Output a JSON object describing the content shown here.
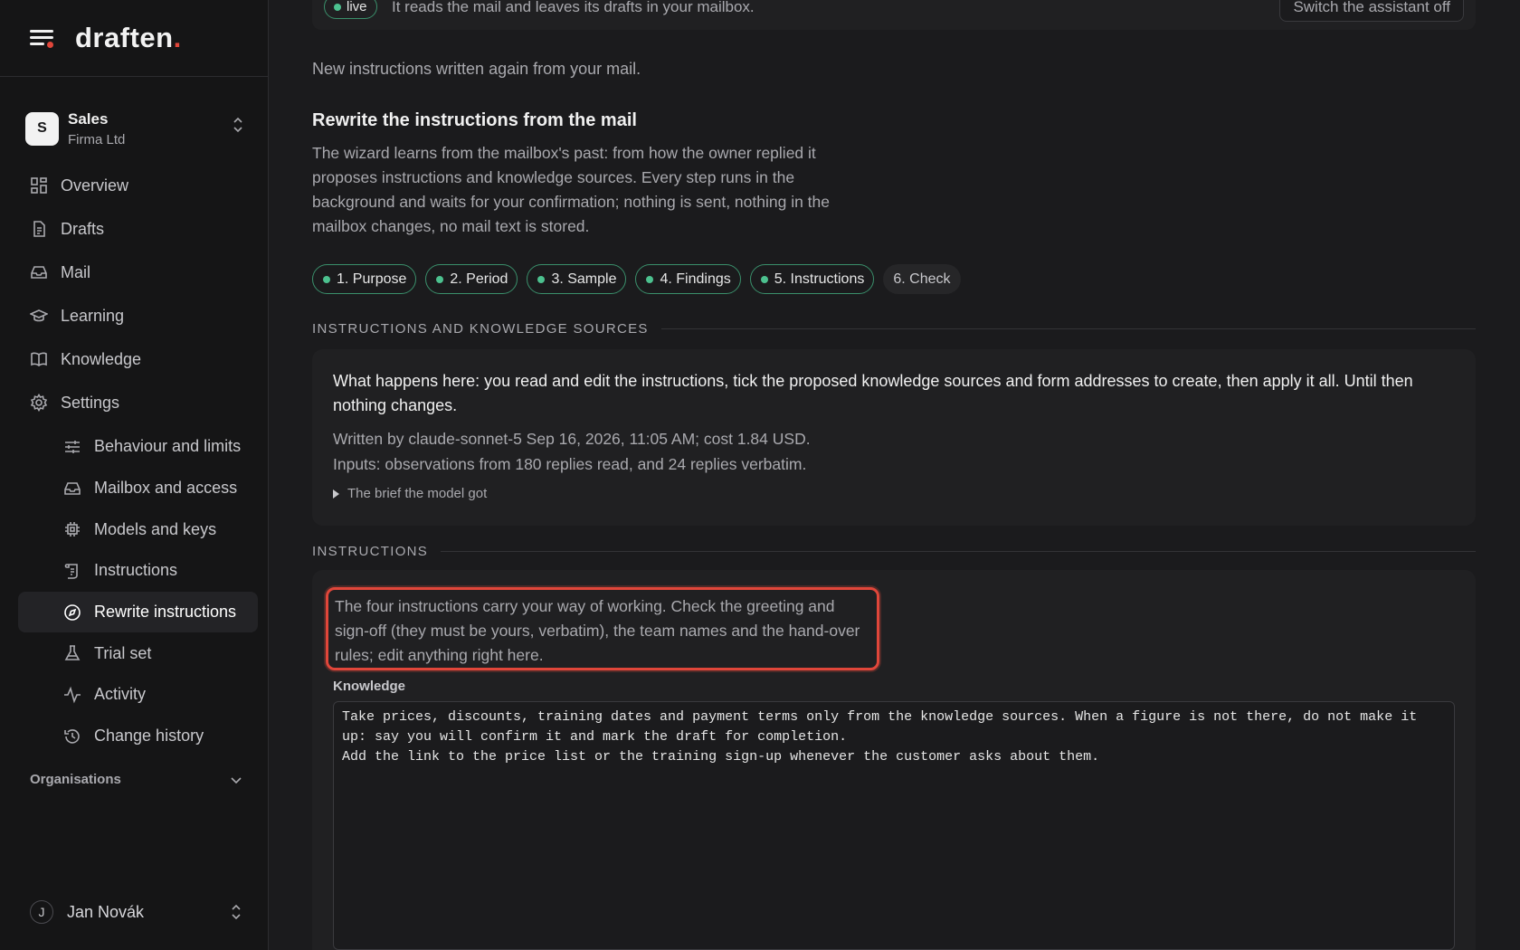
{
  "app": {
    "name": "draften",
    "name_accent": "."
  },
  "org_switcher": {
    "badge": "S",
    "name": "Sales",
    "company": "Firma Ltd"
  },
  "nav": {
    "overview": "Overview",
    "drafts": "Drafts",
    "mail": "Mail",
    "learning": "Learning",
    "knowledge": "Knowledge",
    "settings": "Settings",
    "settings_items": [
      {
        "label": "Behaviour and limits",
        "icon": "sliders-icon"
      },
      {
        "label": "Mailbox and access",
        "icon": "inbox-icon"
      },
      {
        "label": "Models and keys",
        "icon": "chip-icon"
      },
      {
        "label": "Instructions",
        "icon": "scroll-icon"
      },
      {
        "label": "Rewrite instructions",
        "icon": "compass-icon",
        "active": true
      },
      {
        "label": "Trial set",
        "icon": "flask-icon"
      },
      {
        "label": "Activity",
        "icon": "activity-icon"
      },
      {
        "label": "Change history",
        "icon": "history-icon"
      }
    ]
  },
  "organisations": "Organisations",
  "user": {
    "initial": "J",
    "name": "Jan Novák"
  },
  "status_bar": {
    "badge": "live",
    "text": "It reads the mail and leaves its drafts in your mailbox.",
    "button": "Switch the assistant off"
  },
  "lead": "New instructions written again from your mail.",
  "page_title": "Rewrite the instructions from the mail",
  "description": "The wizard learns from the mailbox's past: from how the owner replied it proposes instructions and knowledge sources. Every step runs in the background and waits for your confirmation; nothing is sent, nothing in the mailbox changes, no mail text is stored.",
  "steps": [
    {
      "label": "1. Purpose",
      "done": true
    },
    {
      "label": "2. Period",
      "done": true
    },
    {
      "label": "3. Sample",
      "done": true
    },
    {
      "label": "4. Findings",
      "done": true
    },
    {
      "label": "5. Instructions",
      "done": true
    },
    {
      "label": "6. Check",
      "done": false
    }
  ],
  "section_sources": "INSTRUCTIONS AND KNOWLEDGE SOURCES",
  "info": {
    "what": "What happens here: you read and edit the instructions, tick the proposed knowledge sources and form addresses to create, then apply it all. Until then nothing changes.",
    "written_by": "Written by claude-sonnet-5 Sep 16, 2026, 11:05 AM; cost 1.84 USD.",
    "inputs": "Inputs: observations from 180 replies read, and 24 replies verbatim.",
    "brief": "The brief the model got"
  },
  "section_instructions": "INSTRUCTIONS",
  "hint": "The four instructions carry your way of working. Check the greeting and sign-off (they must be yours, verbatim), the team names and the hand-over rules; edit anything right here.",
  "knowledge": {
    "label": "Knowledge",
    "value": "Take prices, discounts, training dates and payment terms only from the knowledge sources. When a figure is not there, do not make it\nup: say you will confirm it and mark the draft for completion.\nAdd the link to the price list or the training sign-up whenever the customer asks about them."
  },
  "colors": {
    "accent": "#e0463a",
    "success": "#4cc18f",
    "background": "#1b1b1d"
  }
}
